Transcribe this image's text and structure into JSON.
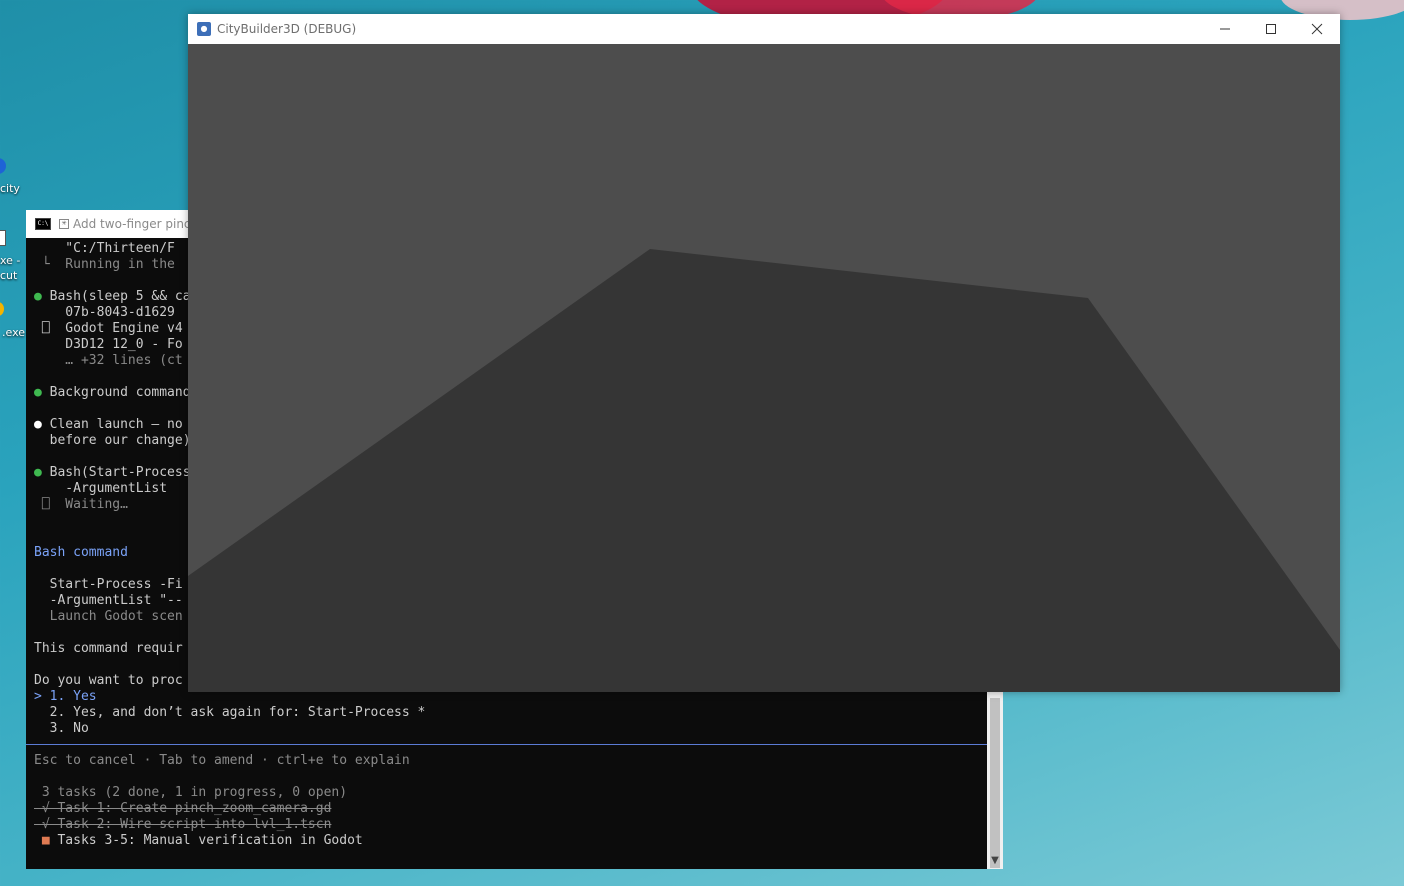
{
  "desktop": {
    "icons": [
      {
        "label": "city"
      },
      {
        "label": "xe -"
      },
      {
        "label": "cut"
      },
      {
        "label": ".exe"
      }
    ]
  },
  "terminal": {
    "title": "Add two-finger pinch",
    "lines": [
      {
        "text": "    \"C:/Thirteen/F",
        "cls": ""
      },
      {
        "text": " └  Running in the ",
        "cls": "dim"
      },
      {
        "text": "",
        "cls": ""
      },
      {
        "text": "● Bash(sleep 5 && ca",
        "cls": ""
      },
      {
        "text": "    07b-8043-d1629",
        "cls": ""
      },
      {
        "text": " ⎕  Godot Engine v4",
        "cls": ""
      },
      {
        "text": "    D3D12 12_0 - Fo",
        "cls": ""
      },
      {
        "text": "    … +32 lines (ct",
        "cls": "dim"
      },
      {
        "text": "",
        "cls": ""
      },
      {
        "text": "● Background command",
        "cls": ""
      },
      {
        "text": "",
        "cls": ""
      },
      {
        "text": "● Clean launch — no ",
        "cls": ""
      },
      {
        "text": "  before our change)",
        "cls": ""
      },
      {
        "text": "",
        "cls": ""
      },
      {
        "text": "● Bash(Start-Process",
        "cls": ""
      },
      {
        "text": "    -ArgumentList ",
        "cls": ""
      },
      {
        "text": " ⎕  Waiting…",
        "cls": "dim"
      },
      {
        "text": "",
        "cls": ""
      },
      {
        "text": "",
        "cls": ""
      },
      {
        "text": "Bash command",
        "cls": "blue"
      },
      {
        "text": "",
        "cls": ""
      },
      {
        "text": "  Start-Process -Fi",
        "cls": ""
      },
      {
        "text": "  -ArgumentList \"--",
        "cls": ""
      },
      {
        "text": "  Launch Godot scen",
        "cls": "dim"
      },
      {
        "text": "",
        "cls": ""
      },
      {
        "text": "This command requir",
        "cls": ""
      },
      {
        "text": "",
        "cls": ""
      },
      {
        "text": "Do you want to proc",
        "cls": ""
      },
      {
        "text": "> 1. Yes",
        "cls": "blue"
      },
      {
        "text": "  2. Yes, and don’t ask again for: Start-Process *",
        "cls": ""
      },
      {
        "text": "  3. No",
        "cls": ""
      },
      {
        "text": "",
        "cls": ""
      },
      {
        "text": "Esc to cancel · Tab to amend · ctrl+e to explain",
        "cls": "dim"
      },
      {
        "text": "",
        "cls": ""
      },
      {
        "text": " 3 tasks (2 done, 1 in progress, 0 open)",
        "cls": "dim"
      },
      {
        "text": " √ Task 1: Create pinch_zoom_camera.gd",
        "cls": "strike"
      },
      {
        "text": " √ Task 2: Wire script into lvl_1.tscn",
        "cls": "strike"
      },
      {
        "text": " ■ Tasks 3-5: Manual verification in Godot",
        "cls": ""
      }
    ]
  },
  "game": {
    "title": "CityBuilder3D (DEBUG)",
    "minimize_icon": "minimize-icon",
    "maximize_icon": "maximize-icon",
    "close_icon": "close-icon"
  }
}
